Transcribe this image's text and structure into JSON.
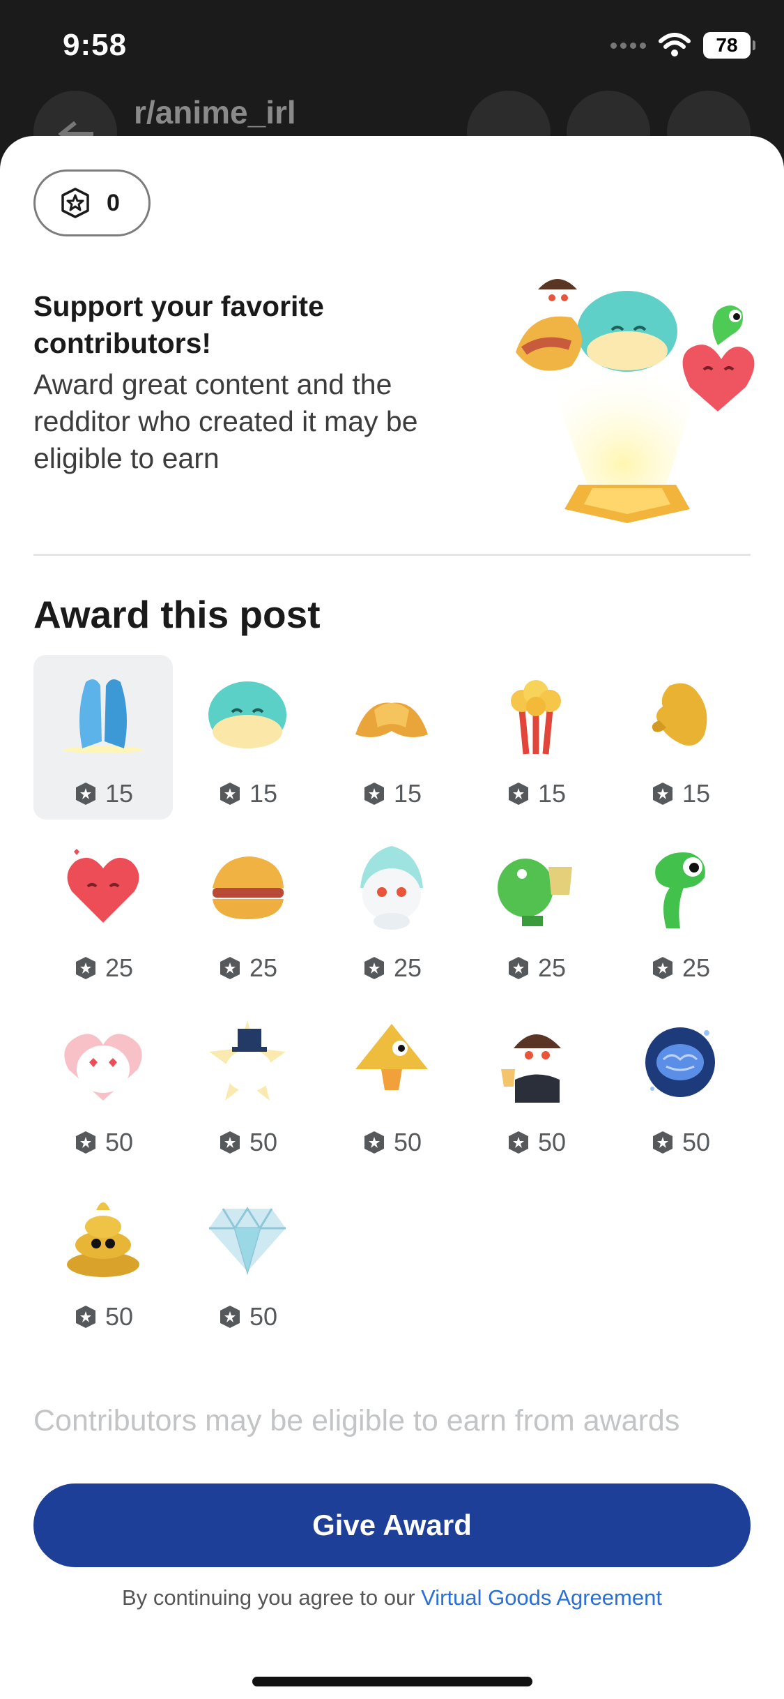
{
  "status_bar": {
    "time": "9:58",
    "battery": "78"
  },
  "background_nav": {
    "subreddit": "r/anime_irl"
  },
  "balance": {
    "value": "0",
    "icon": "gold-coin-icon"
  },
  "intro": {
    "title": "Support your favorite contributors!",
    "body": "Award great content and the redditor who created it may be eligible to earn"
  },
  "section_title": "Award this post",
  "awards": [
    {
      "name": "praying-hands",
      "price": "15",
      "selected": true
    },
    {
      "name": "seal",
      "price": "15"
    },
    {
      "name": "handshake",
      "price": "15"
    },
    {
      "name": "popcorn",
      "price": "15"
    },
    {
      "name": "gold-hand",
      "price": "15"
    },
    {
      "name": "heart",
      "price": "25"
    },
    {
      "name": "burger",
      "price": "25"
    },
    {
      "name": "snoo-fire",
      "price": "25"
    },
    {
      "name": "frog-drink",
      "price": "25"
    },
    {
      "name": "green-snake",
      "price": "25"
    },
    {
      "name": "snoo-hearts",
      "price": "50"
    },
    {
      "name": "snoo-tophat",
      "price": "50"
    },
    {
      "name": "pyramid-eye",
      "price": "50"
    },
    {
      "name": "snoo-tuxedo",
      "price": "50"
    },
    {
      "name": "galaxy-brain",
      "price": "50"
    },
    {
      "name": "gold-poop",
      "price": "50"
    },
    {
      "name": "diamond",
      "price": "50"
    }
  ],
  "footer_note": "Contributors may be eligible to earn from awards",
  "give_button": "Give Award",
  "agreement": {
    "prefix": "By continuing you agree to our ",
    "link": "Virtual Goods Agreement"
  },
  "colors": {
    "accent": "#1e3f98",
    "link": "#2a6fd6"
  }
}
